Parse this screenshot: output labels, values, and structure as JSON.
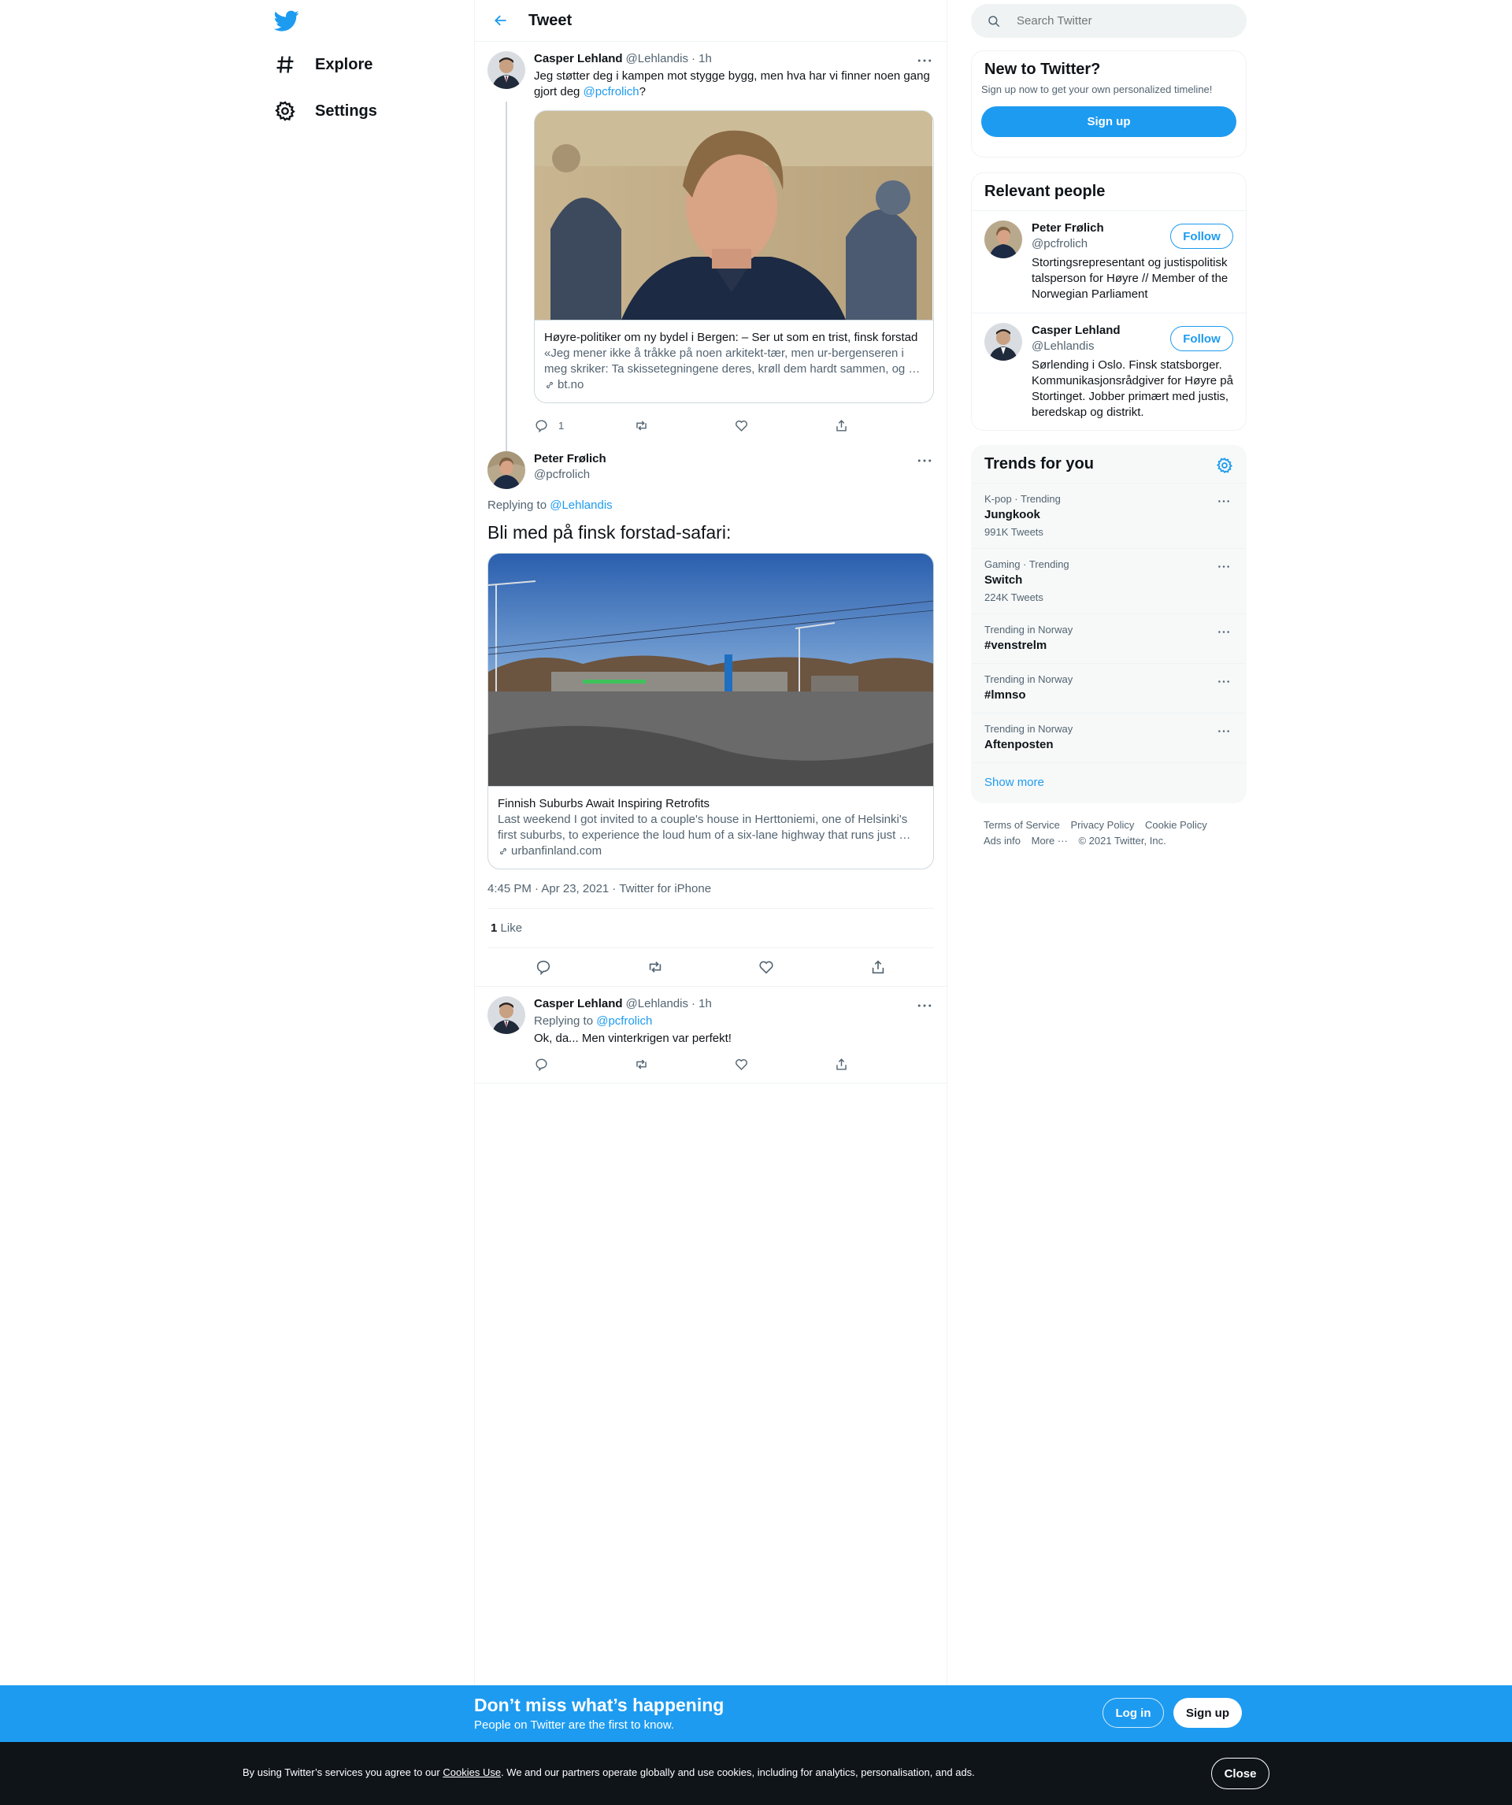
{
  "sidebar": {
    "items": [
      {
        "label": "Explore",
        "icon": "hashtag-icon"
      },
      {
        "label": "Settings",
        "icon": "gear-icon"
      }
    ]
  },
  "header": {
    "title": "Tweet"
  },
  "thread": {
    "parent": {
      "name": "Casper Lehland",
      "handle": "@Lehlandis",
      "time": "· 1h",
      "text_before": "Jeg støtter deg i kampen mot stygge bygg, men hva har vi finner noen gang gjort deg ",
      "mention": "@pcfrolich",
      "text_after": "?",
      "card": {
        "title": "Høyre-politiker om ny bydel i Bergen: – Ser ut som en trist, finsk forstad",
        "description": "«Jeg mener ikke å tråkke på noen arkitekt-tær, men ur-bergenseren i meg skriker: Ta skissetegningene deres, krøll dem hardt sammen, og …",
        "domain": "bt.no"
      },
      "reply_count": "1"
    },
    "main": {
      "name": "Peter Frølich",
      "handle": "@pcfrolich",
      "replying_prefix": "Replying to ",
      "replying_to": "@Lehlandis",
      "text": "Bli med på finsk forstad-safari:",
      "card": {
        "title": "Finnish Suburbs Await Inspiring Retrofits",
        "description": "Last weekend I got invited to a couple's house in Herttoniemi, one of Helsinki's first suburbs, to experience the loud hum of a six-lane highway that runs just …",
        "domain": "urbanfinland.com"
      },
      "timestamp": "4:45 PM · Apr 23, 2021 · Twitter for iPhone",
      "likes_count": "1",
      "likes_label": "Like"
    },
    "reply": {
      "name": "Casper Lehland",
      "handle": "@Lehlandis",
      "time": "· 1h",
      "replying_prefix": "Replying to ",
      "replying_to": "@pcfrolich",
      "text": "Ok, da... Men vinterkrigen var perfekt!"
    }
  },
  "search": {
    "placeholder": "Search Twitter"
  },
  "new_to_twitter": {
    "title": "New to Twitter?",
    "subtitle": "Sign up now to get your own personalized timeline!",
    "button": "Sign up"
  },
  "relevant_people": {
    "title": "Relevant people",
    "people": [
      {
        "name": "Peter Frølich",
        "handle": "@pcfrolich",
        "bio": "Stortingsrepresentant og justispolitisk talsperson for Høyre // Member of the Norwegian Parliament",
        "button": "Follow"
      },
      {
        "name": "Casper Lehland",
        "handle": "@Lehlandis",
        "bio": "Sørlending i Oslo. Finsk statsborger. Kommunikasjonsrådgiver for Høyre på Stortinget. Jobber primært med justis, beredskap og distrikt.",
        "button": "Follow"
      }
    ]
  },
  "trends": {
    "title": "Trends for you",
    "items": [
      {
        "context": "K-pop · Trending",
        "name": "Jungkook",
        "count": "991K Tweets"
      },
      {
        "context": "Gaming · Trending",
        "name": "Switch",
        "count": "224K Tweets"
      },
      {
        "context": "Trending in Norway",
        "name": "#venstrelm",
        "count": ""
      },
      {
        "context": "Trending in Norway",
        "name": "#lmnso",
        "count": ""
      },
      {
        "context": "Trending in Norway",
        "name": "Aftenposten",
        "count": ""
      }
    ],
    "show_more": "Show more"
  },
  "footer": {
    "links": [
      "Terms of Service",
      "Privacy Policy",
      "Cookie Policy",
      "Ads info",
      "More ···"
    ],
    "copyright": "© 2021 Twitter, Inc."
  },
  "banner": {
    "title": "Don’t miss what’s happening",
    "subtitle": "People on Twitter are the first to know.",
    "login": "Log in",
    "signup": "Sign up"
  },
  "cookie": {
    "text_before": "By using Twitter’s services you agree to our ",
    "link": "Cookies Use",
    "text_after": ". We and our partners operate globally and use cookies, including for analytics, personalisation, and ads.",
    "close": "Close"
  },
  "colors": {
    "accent": "#1d9bf0",
    "text": "#0f1419",
    "muted": "#536471",
    "border": "#eff3f4"
  }
}
